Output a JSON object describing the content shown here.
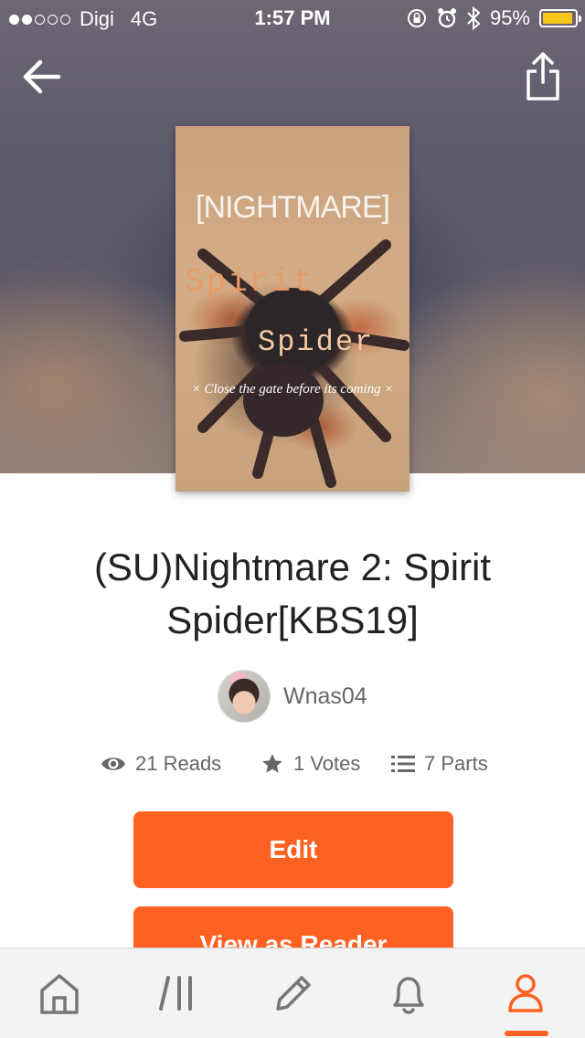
{
  "status_bar": {
    "carrier": "Digi",
    "network": "4G",
    "time": "1:57 PM",
    "battery": "95%",
    "battery_level": 0.95,
    "signal_bars_filled": 2,
    "signal_bars_total": 5
  },
  "nav": {
    "back_icon": "arrow-left-icon",
    "share_icon": "share-icon"
  },
  "cover": {
    "line1": "[NIGHTMARE]",
    "line2": "Spirit",
    "line3": "Spider",
    "line4": "× Close the gate before its coming ×"
  },
  "story": {
    "title": "(SU)Nightmare 2: Spirit Spider[KBS19]",
    "author": "Wnas04"
  },
  "stats": {
    "reads": "21 Reads",
    "votes": "1 Votes",
    "parts": "7 Parts"
  },
  "actions": {
    "edit": "Edit",
    "view_as_reader": "View as Reader"
  },
  "tab_bar": {
    "items": [
      "home-icon",
      "library-icon",
      "pencil-icon",
      "bell-icon",
      "profile-icon"
    ],
    "active": "profile-icon"
  },
  "colors": {
    "accent": "#ff6122",
    "battery": "#f5c518"
  }
}
